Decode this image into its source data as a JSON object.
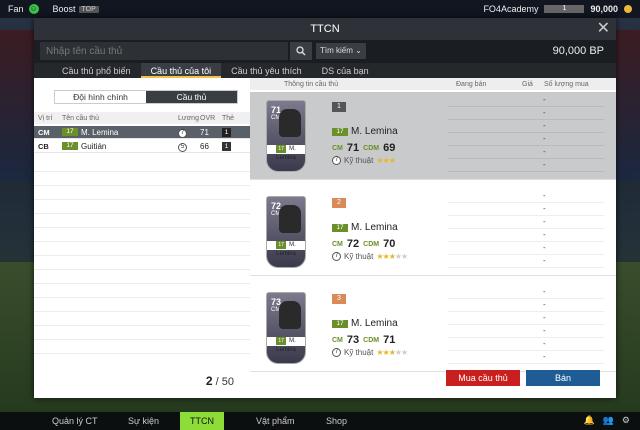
{
  "topbar": {
    "fan_label": "Fan",
    "boost_label": "Boost",
    "boost_badge": "TOP",
    "club_name": "FO4Academy",
    "level": "1",
    "coins": "90,000"
  },
  "dialog": {
    "title": "TTCN"
  },
  "search": {
    "placeholder": "Nhập tên cầu thủ",
    "filter_label": "Tìm kiếm",
    "bp": "90,000 BP"
  },
  "tabs": [
    "Cầu thủ phổ biến",
    "Cầu thủ của tôi",
    "Cầu thủ yêu thích",
    "DS của bạn"
  ],
  "left": {
    "seg": [
      "Đội hình chính",
      "Cầu thủ"
    ],
    "headers": {
      "pos": "Vị trí",
      "name": "Tên cầu thủ",
      "salary": "Lương",
      "ovr": "OVR",
      "the": "Thẻ"
    },
    "rows": [
      {
        "pos": "CM",
        "badge": "17",
        "name": "M. Lemina",
        "salary": "7",
        "ovr": "71",
        "the": "1"
      },
      {
        "pos": "CB",
        "badge": "17",
        "name": "Guitián",
        "salary": "5",
        "ovr": "66",
        "the": "1"
      }
    ],
    "page_current": "2",
    "page_total": "/ 50"
  },
  "right": {
    "headers": {
      "info": "Thông tin cầu thủ",
      "selling": "Đang bán",
      "price": "Giá",
      "qty": "Số lượng mua"
    },
    "cards": [
      {
        "rank": "1",
        "ovr": "71",
        "pos": "CM",
        "badge": "17",
        "name": "M. Lemina",
        "k1": "CM",
        "v1": "71",
        "k2": "CDM",
        "v2": "69",
        "salary": "7",
        "skill_label": "Kỹ thuật",
        "stars": "★★★",
        "stars_off": "★★",
        "card_name": "M. Lemina",
        "card_badge": "17"
      },
      {
        "rank": "2",
        "ovr": "72",
        "pos": "CM",
        "badge": "17",
        "name": "M. Lemina",
        "k1": "CM",
        "v1": "72",
        "k2": "CDM",
        "v2": "70",
        "salary": "7",
        "skill_label": "Kỹ thuật",
        "stars": "★★★",
        "stars_off": "★★",
        "card_name": "M. Lemina",
        "card_badge": "17"
      },
      {
        "rank": "3",
        "ovr": "73",
        "pos": "CM",
        "badge": "17",
        "name": "M. Lemina",
        "k1": "CM",
        "v1": "73",
        "k2": "CDM",
        "v2": "71",
        "salary": "7",
        "skill_label": "Kỹ thuật",
        "stars": "★★★",
        "stars_off": "★★",
        "card_name": "M. Lemina",
        "card_badge": "17"
      }
    ],
    "dash": "-",
    "buy_label": "Mua cầu thủ",
    "sell_label": "Bán"
  },
  "bottomnav": [
    "Quản lý CT",
    "Sự kiện",
    "TTCN",
    "Vật phẩm",
    "Shop"
  ],
  "colors": {
    "accent_green": "#8ddc37",
    "buy_red": "#c9201f",
    "sell_blue": "#1f5c95",
    "rank_bronze": "#d98a58"
  }
}
